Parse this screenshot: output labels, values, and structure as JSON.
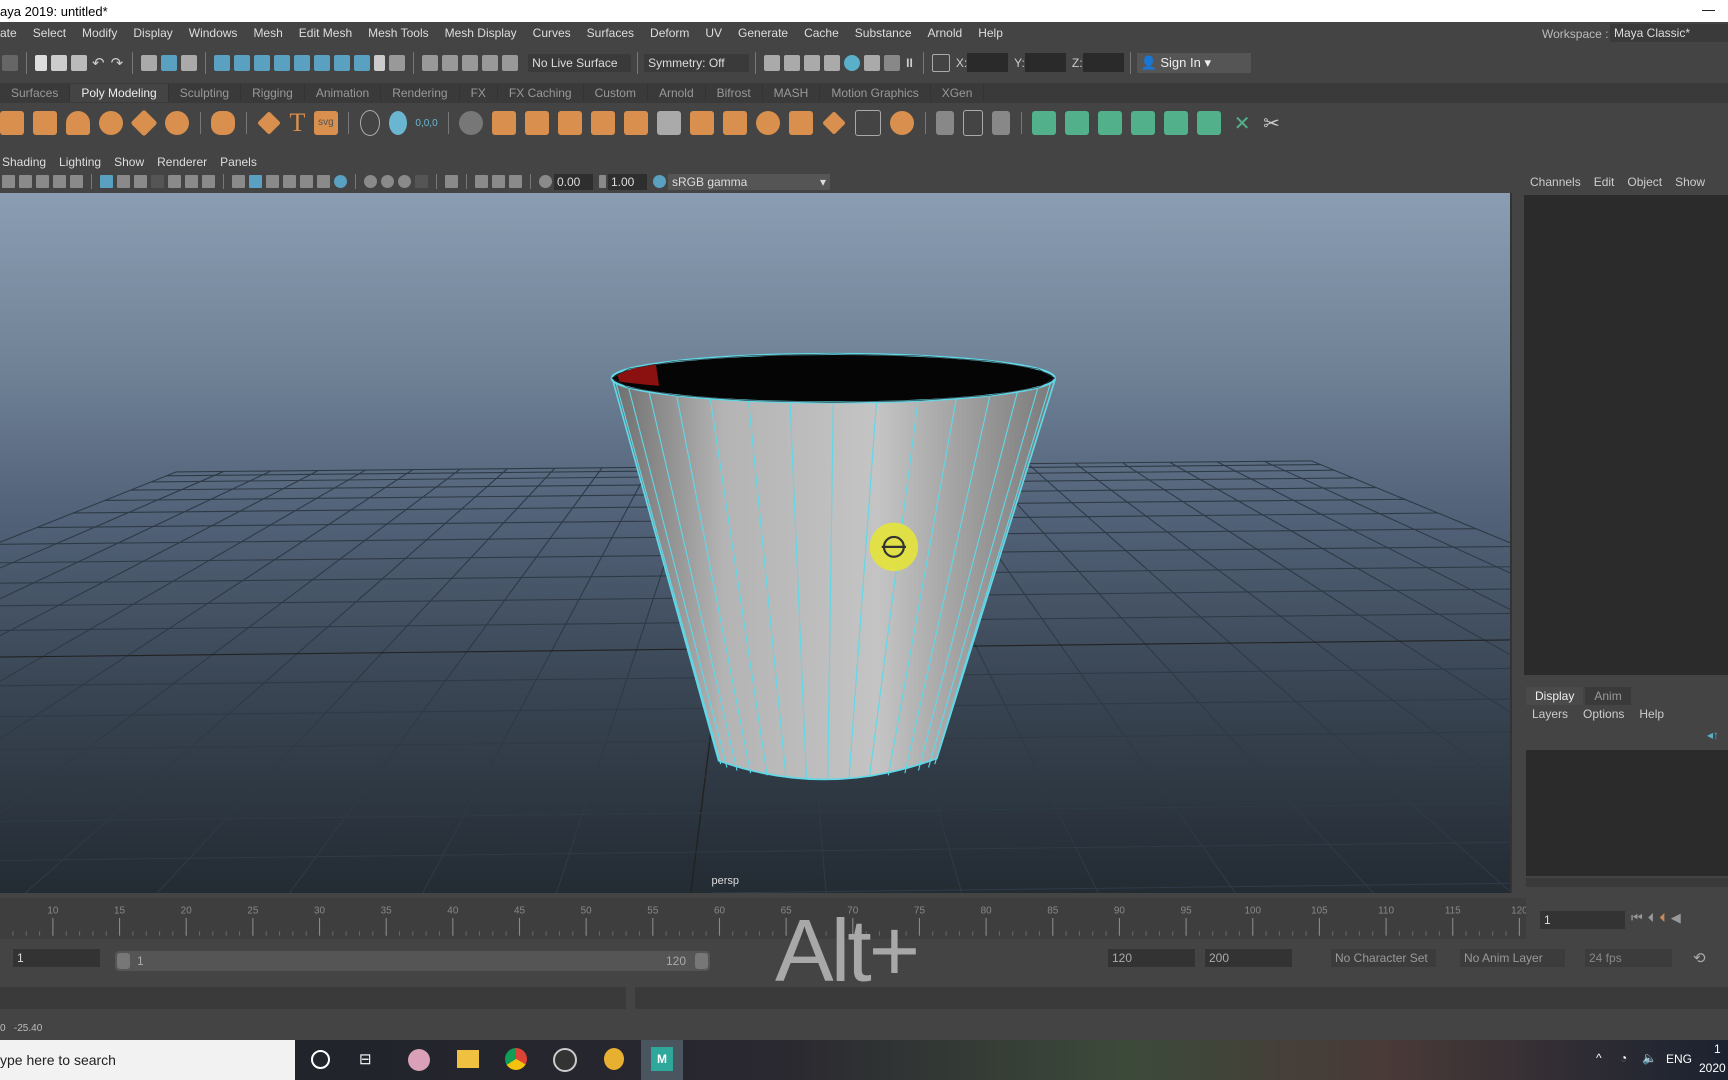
{
  "window": {
    "title": "aya 2019: untitled*"
  },
  "menubar": [
    "ate",
    "Select",
    "Modify",
    "Display",
    "Windows",
    "Mesh",
    "Edit Mesh",
    "Mesh Tools",
    "Mesh Display",
    "Curves",
    "Surfaces",
    "Deform",
    "UV",
    "Generate",
    "Cache",
    "Substance",
    "Arnold",
    "Help"
  ],
  "workspace": {
    "label": "Workspace :",
    "value": "Maya Classic*"
  },
  "status": {
    "live_surface": "No Live Surface",
    "symmetry": "Symmetry: Off",
    "x_label": "X:",
    "y_label": "Y:",
    "z_label": "Z:",
    "sign_in": "Sign In"
  },
  "shelf": {
    "tabs": [
      "Surfaces",
      "Poly Modeling",
      "Sculpting",
      "Rigging",
      "Animation",
      "Rendering",
      "FX",
      "FX Caching",
      "Custom",
      "Arnold",
      "Bifrost",
      "MASH",
      "Motion Graphics",
      "XGen"
    ],
    "active": "Poly Modeling",
    "svg_label": "svg",
    "origin_label": "0,0,0"
  },
  "viewport": {
    "menu": [
      "Shading",
      "Lighting",
      "Show",
      "Renderer",
      "Panels"
    ],
    "exposure": "0.00",
    "gamma": "1.00",
    "color_space": "sRGB gamma",
    "camera": "persp"
  },
  "channel_box": {
    "menu": [
      "Channels",
      "Edit",
      "Object",
      "Show"
    ]
  },
  "layer_editor": {
    "tabs": [
      "Display",
      "Anim"
    ],
    "menu": [
      "Layers",
      "Options",
      "Help"
    ]
  },
  "timeline": {
    "ticks": [
      "10",
      "15",
      "20",
      "25",
      "30",
      "35",
      "40",
      "45",
      "50",
      "55",
      "60",
      "65",
      "70",
      "75",
      "80",
      "85",
      "90",
      "95",
      "100",
      "105",
      "110",
      "115",
      "120"
    ],
    "current_frame": "1"
  },
  "range": {
    "start": "1",
    "slider_start": "1",
    "slider_end": "120",
    "end": "120",
    "anim_end": "200",
    "character_set": "No Character Set",
    "anim_layer": "No Anim Layer",
    "fps": "24 fps"
  },
  "helpline": {
    "values": "0   -25.40"
  },
  "overlay": {
    "keystroke": "Alt+"
  },
  "taskbar": {
    "search_placeholder": "ype here to search",
    "lang": "ENG",
    "clock": "1",
    "date": "2020"
  },
  "colors": {
    "accent": "#5aa0c0",
    "shelf_orange": "#d98f4d",
    "shelf_green": "#52b08a",
    "wireframe": "#5fd8e8"
  }
}
